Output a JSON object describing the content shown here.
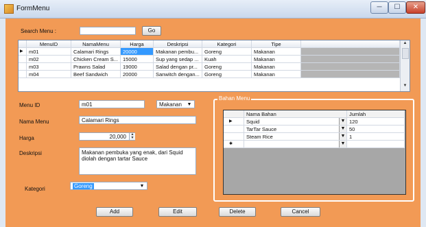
{
  "window": {
    "title": "FormMenu",
    "controls": [
      "─",
      "☐",
      "✕"
    ]
  },
  "search": {
    "label": "Search Menu :",
    "value": "",
    "go_label": "Go"
  },
  "menu_grid": {
    "columns": [
      "MenuID",
      "NamaMenu",
      "Harga",
      "Deskripsi",
      "Kategori",
      "Tipe"
    ],
    "rows": [
      [
        "m01",
        "Calamari Rings",
        "20000",
        "Makanan pembu...",
        "Goreng",
        "Makanan"
      ],
      [
        "m02",
        "Chicken Cream S...",
        "15000",
        "Sup yang sedap ...",
        "Kuah",
        "Makanan"
      ],
      [
        "m03",
        "Prawns Salad",
        "19000",
        "Salad dengan pr...",
        "Goreng",
        "Makanan"
      ],
      [
        "m04",
        "Beef Sandwich",
        "20000",
        "Sanwitch dengan...",
        "Goreng",
        "Makanan"
      ]
    ],
    "current_row_marker": "▶"
  },
  "form": {
    "menu_id_label": "Menu ID",
    "menu_id": "m01",
    "tipe_value": "Makanan",
    "nama_label": "Nama Menu",
    "nama": "Calamari Rings",
    "harga_label": "Harga",
    "harga": "20,000",
    "deskripsi_label": "Deskripsi",
    "deskripsi": "Makanan pembuka yang enak, dari Squid diolah dengan tartar Sauce",
    "kategori_label": "Kategori",
    "kategori": "Goreng"
  },
  "bahan": {
    "group_title": "Bahan Menu",
    "columns": [
      "Nama Bahan",
      "Jumlah"
    ],
    "rows": [
      {
        "nama": "Squid",
        "jumlah": "120"
      },
      {
        "nama": "TarTar Sauce",
        "jumlah": "50"
      },
      {
        "nama": "Steam Rice",
        "jumlah": "1"
      },
      {
        "nama": "",
        "jumlah": ""
      }
    ],
    "current_row_marker": "▶",
    "new_row_marker": "✱"
  },
  "buttons": {
    "add": "Add",
    "edit": "Edit",
    "delete": "Delete",
    "cancel": "Cancel"
  },
  "colors": {
    "form_bg": "#f29a55",
    "selection": "#3399ff"
  }
}
